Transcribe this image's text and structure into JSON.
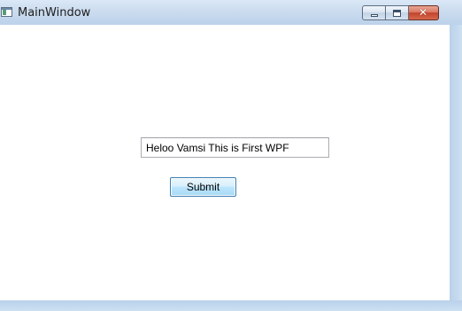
{
  "window": {
    "title": "MainWindow",
    "icon": "window-app-icon",
    "controls": {
      "minimize_icon": "minimize-icon",
      "maximize_icon": "maximize-icon",
      "close_icon": "close-icon",
      "close_glyph": "✕"
    }
  },
  "form": {
    "text_input_value": "Heloo Vamsi This is First WPF",
    "submit_label": "Submit"
  },
  "colors": {
    "frame": "#b9d1ea",
    "button_border": "#3c7fb1",
    "close_button": "#c2432b"
  }
}
